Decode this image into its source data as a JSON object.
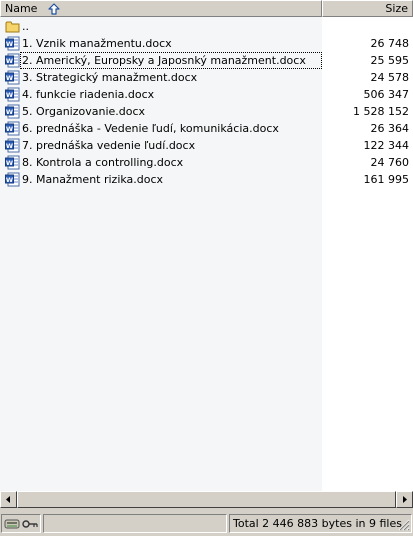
{
  "header": {
    "name_label": "Name",
    "size_label": "Size"
  },
  "parent_row": {
    "name": ".."
  },
  "files": [
    {
      "name": "1. Vznik manažmentu.docx",
      "size": "26 748"
    },
    {
      "name": "2. Americký, Europsky a Japosnký manažment.docx",
      "size": "25 595"
    },
    {
      "name": "3. Strategický manažment.docx",
      "size": "24 578"
    },
    {
      "name": "4. funkcie riadenia.docx",
      "size": "506 347"
    },
    {
      "name": "5. Organizovanie.docx",
      "size": "1 528 152"
    },
    {
      "name": "6. prednáška - Vedenie ľudí, komunikácia.docx",
      "size": "26 364"
    },
    {
      "name": "7. prednáška vedenie ľudí.docx",
      "size": "122 344"
    },
    {
      "name": "8. Kontrola a controlling.docx",
      "size": "24 760"
    },
    {
      "name": "9. Manažment rizika.docx",
      "size": "161 995"
    }
  ],
  "status": {
    "selection": "",
    "summary": "Total 2 446 883 bytes in 9 files"
  },
  "colors": {
    "list_bg": "#f5f6f7",
    "window_bg": "#d4d0c8",
    "folder": "#f5d46b",
    "word_blue": "#2a5bb5"
  },
  "icons": {
    "parent": "folder-icon",
    "file": "word-document-icon",
    "sort": "sort-ascending-arrow-icon"
  }
}
